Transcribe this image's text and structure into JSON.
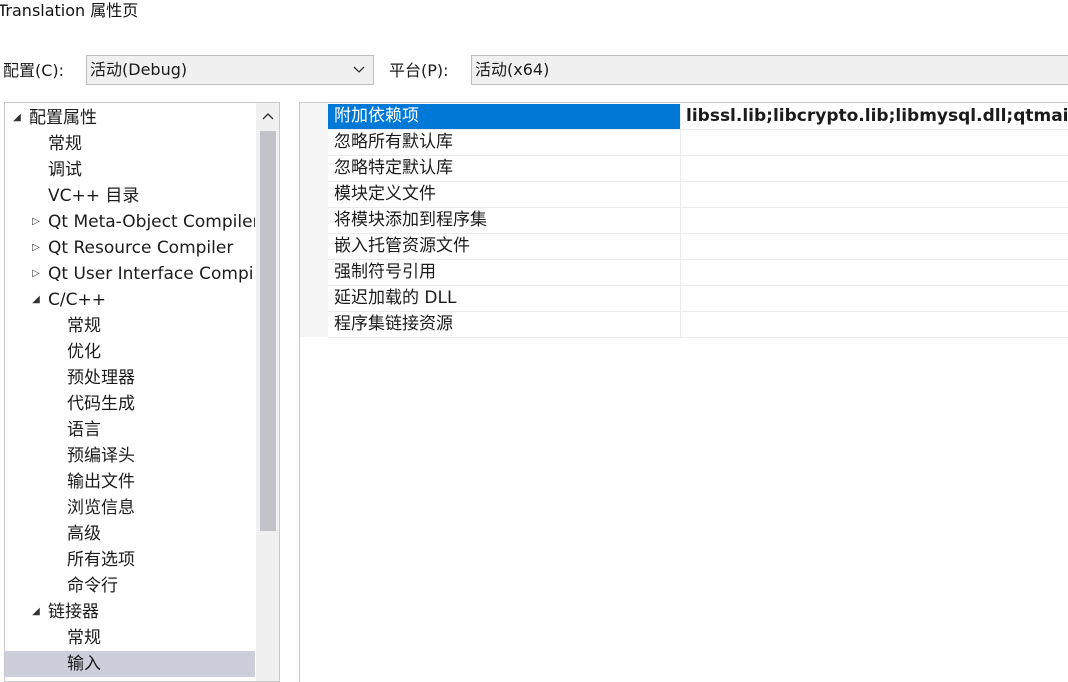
{
  "window": {
    "title": "Translation 属性页"
  },
  "config": {
    "config_label": "配置(C):",
    "config_value": "活动(Debug)",
    "platform_label": "平台(P):",
    "platform_value": "活动(x64)"
  },
  "tree": {
    "items": [
      {
        "label": "配置属性",
        "expander": "▲"
      },
      {
        "label": "常规",
        "expander": ""
      },
      {
        "label": "调试",
        "expander": ""
      },
      {
        "label": "VC++ 目录",
        "expander": ""
      },
      {
        "label": "Qt Meta-Object Compiler",
        "expander": "▷"
      },
      {
        "label": "Qt Resource Compiler",
        "expander": "▷"
      },
      {
        "label": "Qt User Interface Compiler",
        "expander": "▷"
      },
      {
        "label": "C/C++",
        "expander": "▲"
      },
      {
        "label": "常规",
        "expander": ""
      },
      {
        "label": "优化",
        "expander": ""
      },
      {
        "label": "预处理器",
        "expander": ""
      },
      {
        "label": "代码生成",
        "expander": ""
      },
      {
        "label": "语言",
        "expander": ""
      },
      {
        "label": "预编译头",
        "expander": ""
      },
      {
        "label": "输出文件",
        "expander": ""
      },
      {
        "label": "浏览信息",
        "expander": ""
      },
      {
        "label": "高级",
        "expander": ""
      },
      {
        "label": "所有选项",
        "expander": ""
      },
      {
        "label": "命令行",
        "expander": ""
      },
      {
        "label": "链接器",
        "expander": "▲"
      },
      {
        "label": "常规",
        "expander": ""
      },
      {
        "label": "输入",
        "expander": "",
        "selected": true
      }
    ]
  },
  "properties": {
    "rows": [
      {
        "name": "附加依赖项",
        "value": "libssl.lib;libcrypto.lib;libmysql.dll;qtmaind.lib",
        "selected": true
      },
      {
        "name": "忽略所有默认库",
        "value": ""
      },
      {
        "name": "忽略特定默认库",
        "value": ""
      },
      {
        "name": "模块定义文件",
        "value": ""
      },
      {
        "name": "将模块添加到程序集",
        "value": ""
      },
      {
        "name": "嵌入托管资源文件",
        "value": ""
      },
      {
        "name": "强制符号引用",
        "value": ""
      },
      {
        "name": "延迟加载的 DLL",
        "value": ""
      },
      {
        "name": "程序集链接资源",
        "value": ""
      }
    ]
  },
  "colors": {
    "selection_blue": "#0078d7",
    "tree_selection": "#cccedb"
  }
}
